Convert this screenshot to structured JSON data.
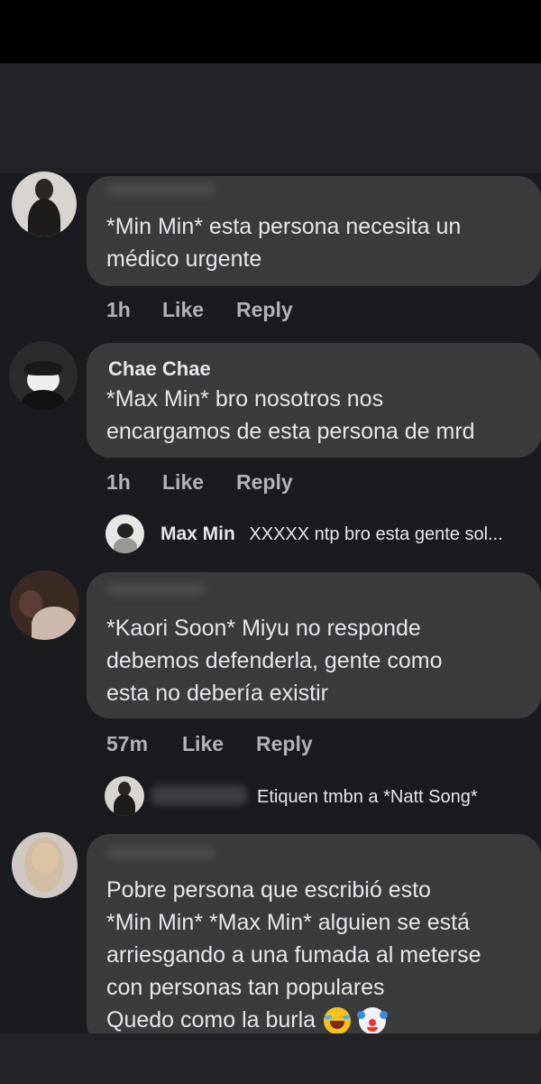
{
  "comments": [
    {
      "author": "",
      "lines": [
        "*Min Min* esta persona necesita un",
        "médico urgente"
      ],
      "time": "1h",
      "like": "Like",
      "reply": "Reply"
    },
    {
      "author": "Chae Chae",
      "lines": [
        "*Max Min* bro nosotros nos",
        "encargamos de esta persona de mrd"
      ],
      "time": "1h",
      "like": "Like",
      "reply": "Reply",
      "reply_preview": {
        "author": "Max Min",
        "text": "XXXXX ntp bro esta gente sol..."
      }
    },
    {
      "author": "",
      "lines": [
        "*Kaori Soon* Miyu no responde",
        "debemos defenderla, gente como",
        "esta no debería existir"
      ],
      "time": "57m",
      "like": "Like",
      "reply": "Reply",
      "reply_preview": {
        "author": "",
        "text": "Etiquen tmbn a *Natt Song*"
      }
    },
    {
      "author": "",
      "lines": [
        "Pobre persona que escribió esto",
        "*Min Min* *Max Min* alguien se está",
        "arriesgando a una fumada al meterse",
        "con personas tan populares",
        "Quedo como la burla"
      ],
      "emojis": [
        "laughing-crying-emoji",
        "clown-emoji"
      ]
    }
  ],
  "colors": {
    "bubble": "#3a3b3c",
    "background": "#1a1b1e",
    "meta": "#b0b3b8"
  }
}
